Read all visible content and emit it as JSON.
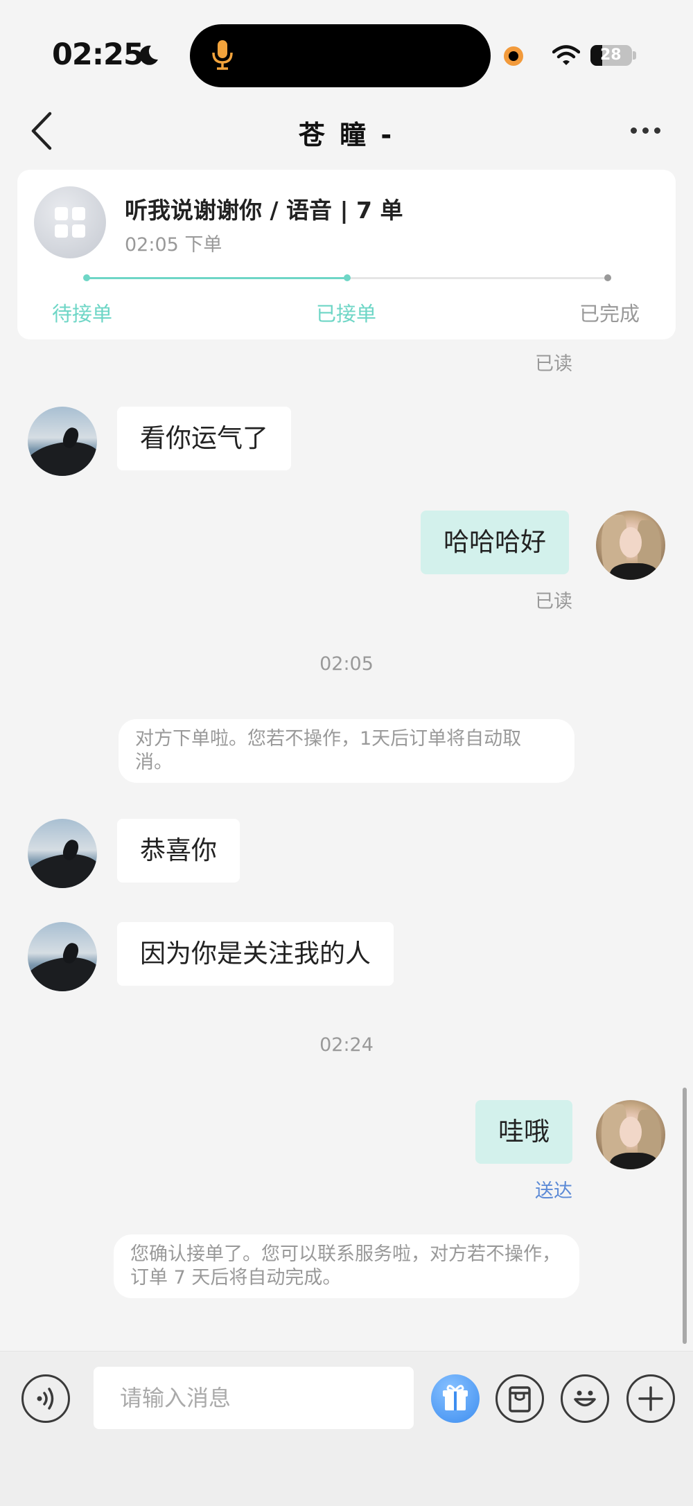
{
  "status_bar": {
    "time": "02:25",
    "battery": "28"
  },
  "nav": {
    "title": "苍 瞳 -"
  },
  "order": {
    "title": "听我说谢谢你 / 语音 | 7 单",
    "time": "02:05 下单",
    "steps": [
      "待接单",
      "已接单",
      "已完成"
    ],
    "current_step": 2,
    "colors": {
      "active": "#6ed6c6",
      "inactive": "#999999"
    }
  },
  "messages": [
    {
      "type": "read",
      "text": "已读"
    },
    {
      "type": "received",
      "text": "看你运气了"
    },
    {
      "type": "sent",
      "text": "哈哈哈好",
      "status": "已读"
    },
    {
      "type": "timestamp",
      "text": "02:05"
    },
    {
      "type": "system",
      "text": "对方下单啦。您若不操作，1天后订单将自动取消。"
    },
    {
      "type": "received",
      "text": "恭喜你"
    },
    {
      "type": "received",
      "text": "因为你是关注我的人"
    },
    {
      "type": "timestamp",
      "text": "02:24"
    },
    {
      "type": "sent",
      "text": "哇哦",
      "status": "送达"
    },
    {
      "type": "system",
      "text": "您确认接单了。您可以联系服务啦，对方若不操作，订单 7 天后将自动完成。"
    }
  ],
  "input": {
    "placeholder": "请输入消息"
  },
  "toolbar": [
    "voice-icon",
    "gift-icon",
    "order-icon",
    "emoji-icon",
    "plus-icon"
  ]
}
